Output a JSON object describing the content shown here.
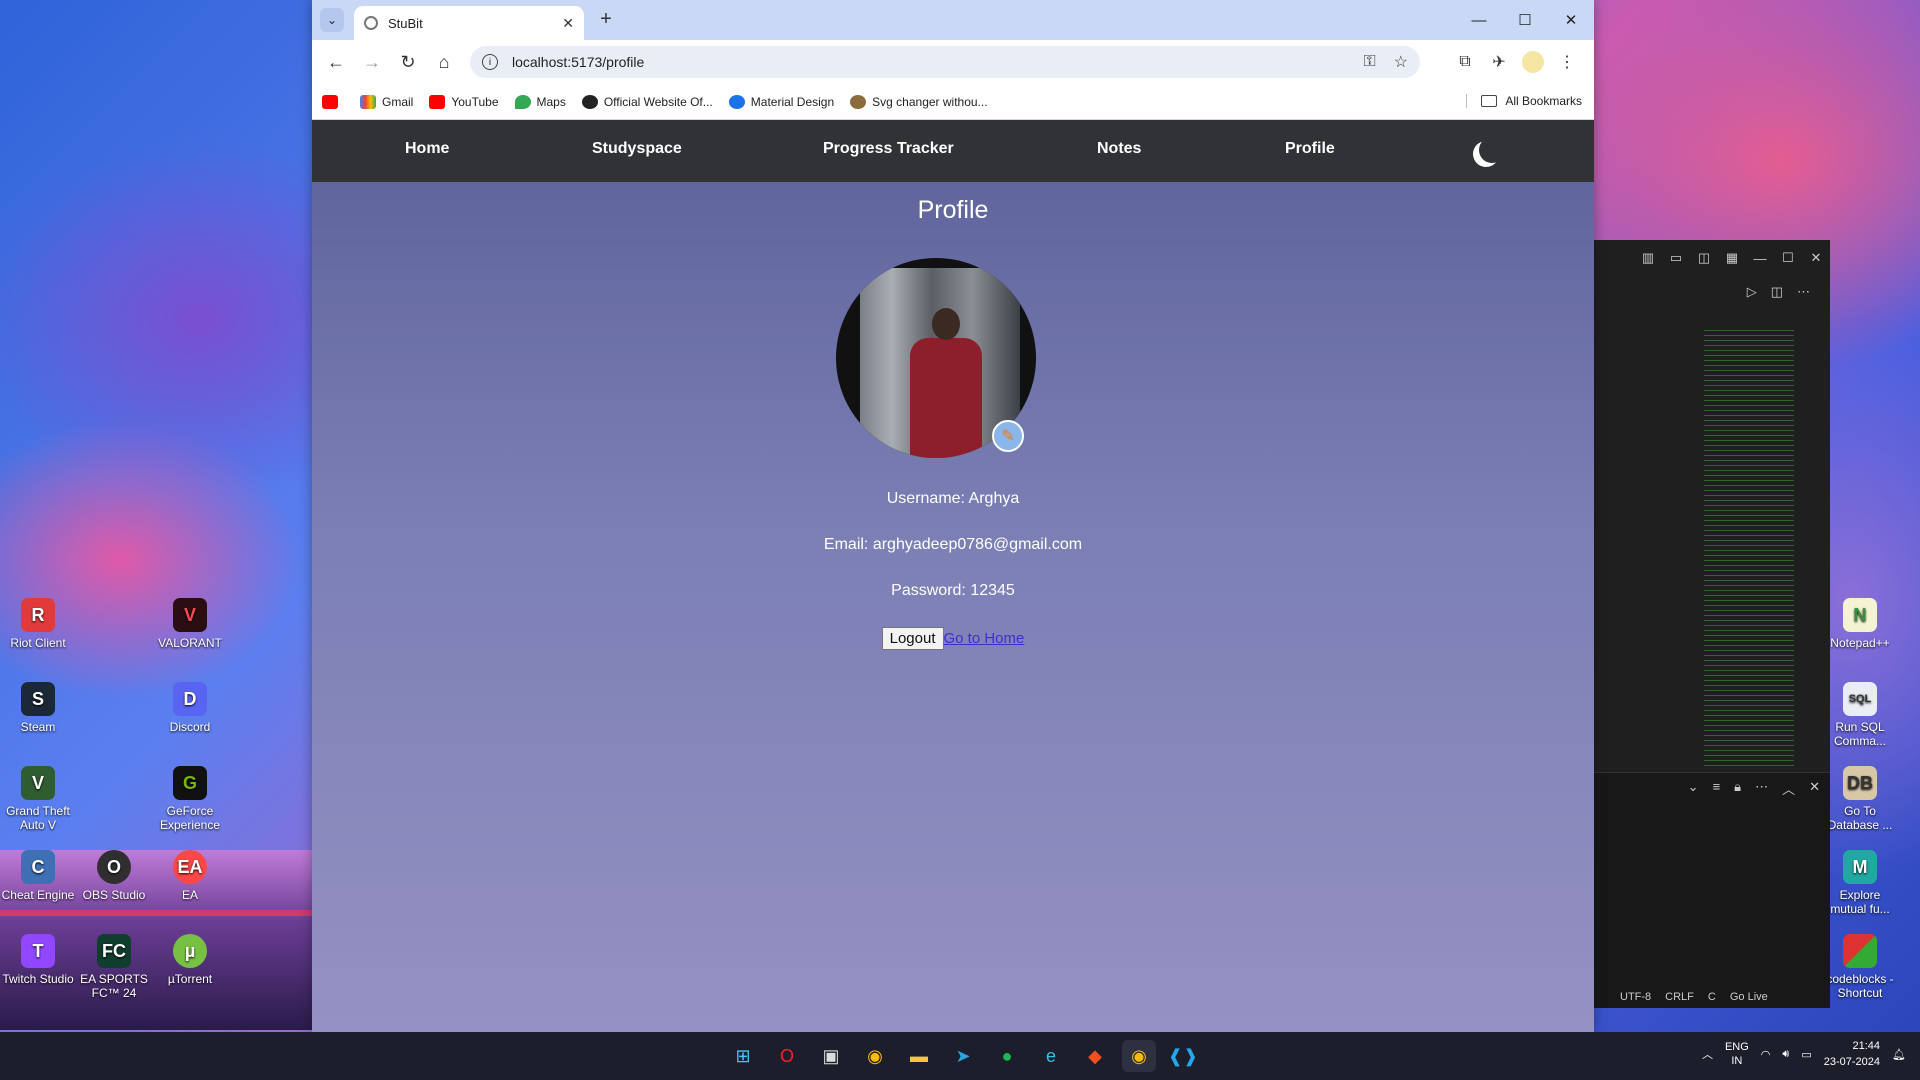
{
  "browser": {
    "tab_title": "StuBit",
    "url": "localhost:5173/profile",
    "bookmarks": [
      {
        "label": "",
        "icon": "youtube-icon",
        "color": "#ff0000"
      },
      {
        "label": "Gmail",
        "icon": "gmail-icon",
        "color": "#ea4335"
      },
      {
        "label": "YouTube",
        "icon": "youtube-icon",
        "color": "#ff0000"
      },
      {
        "label": "Maps",
        "icon": "maps-icon",
        "color": "#34a853"
      },
      {
        "label": "Official Website Of...",
        "icon": "globe-icon",
        "color": "#222222"
      },
      {
        "label": "Material Design",
        "icon": "material-icon",
        "color": "#1a73e8"
      },
      {
        "label": "Svg changer withou...",
        "icon": "svg-icon",
        "color": "#8a6d3b"
      }
    ],
    "all_bookmarks": "All Bookmarks"
  },
  "app": {
    "nav": {
      "home": "Home",
      "studyspace": "Studyspace",
      "progress_tracker": "Progress Tracker",
      "notes": "Notes",
      "profile": "Profile",
      "theme_toggle_icon": "moon-icon"
    },
    "profile": {
      "title": "Profile",
      "username": "Username: Arghya",
      "email": "Email: arghyadeep0786@gmail.com",
      "password": "Password: 12345",
      "logout_label": "Logout",
      "home_link": "Go to Home"
    }
  },
  "desktop": {
    "icons_left": [
      "Riot Client",
      "VALORANT",
      "Steam",
      "Discord",
      "Grand Theft Auto V",
      "GeForce Experience",
      "Cheat Engine",
      "OBS Studio",
      "EA",
      "Twitch Studio",
      "EA SPORTS FC™ 24",
      "µTorrent"
    ],
    "icons_right": [
      "Notepad++",
      "Run SQL Comma...",
      "Go To Database ...",
      "Explore mutual fu...",
      "codeblocks - Shortcut"
    ]
  },
  "vscode": {
    "status": [
      "UTF-8",
      "CRLF",
      "C",
      "Go Live"
    ]
  },
  "taskbar": {
    "lang_line1": "ENG",
    "lang_line2": "IN",
    "time": "21:44",
    "date": "23-07-2024"
  }
}
